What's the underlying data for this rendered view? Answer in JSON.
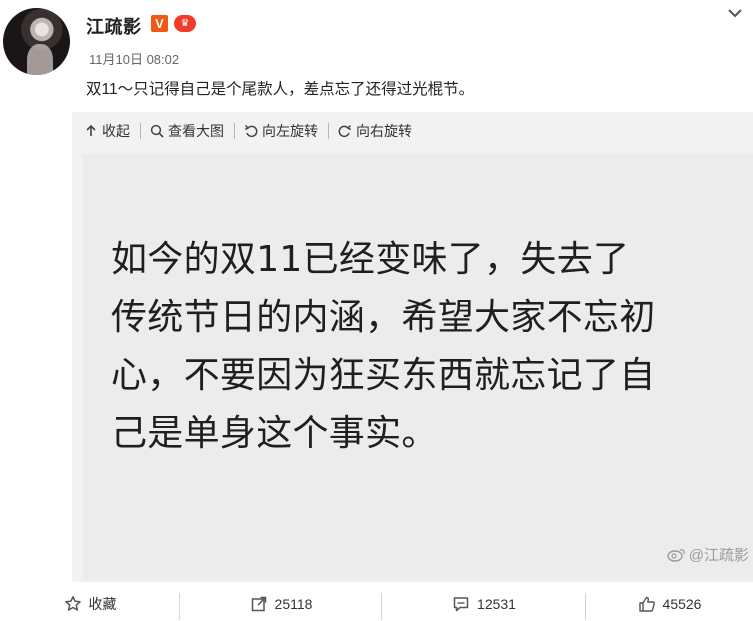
{
  "post": {
    "username": "江疏影",
    "verified_badge": "V",
    "member_badge": "♛",
    "time": "11月10日 08:02",
    "text": "双11～只记得自己是个尾款人，差点忘了还得过光棍节。"
  },
  "media_toolbar": {
    "collapse": "收起",
    "view_large": "查看大图",
    "rotate_left": "向左旋转",
    "rotate_right": "向右旋转"
  },
  "image": {
    "lines": [
      "如今的双11已经变味了，失去了",
      "传统节日的内涵，希望大家不忘初",
      "心，不要因为狂买东西就忘记了自",
      "己是单身这个事实。"
    ],
    "watermark": "@江疏影"
  },
  "actions": {
    "favorite": "收藏",
    "repost_count": "25118",
    "comment_count": "12531",
    "like_count": "45526"
  },
  "colors": {
    "verified_badge": "#f05a12",
    "member_badge": "#ef3b2a",
    "media_background": "#f2f2f2"
  },
  "icons": [
    "chevron-down-icon",
    "collapse-icon",
    "magnifier-icon",
    "rotate-left-icon",
    "rotate-right-icon",
    "star-icon",
    "repost-icon",
    "comment-icon",
    "thumbs-up-icon"
  ]
}
